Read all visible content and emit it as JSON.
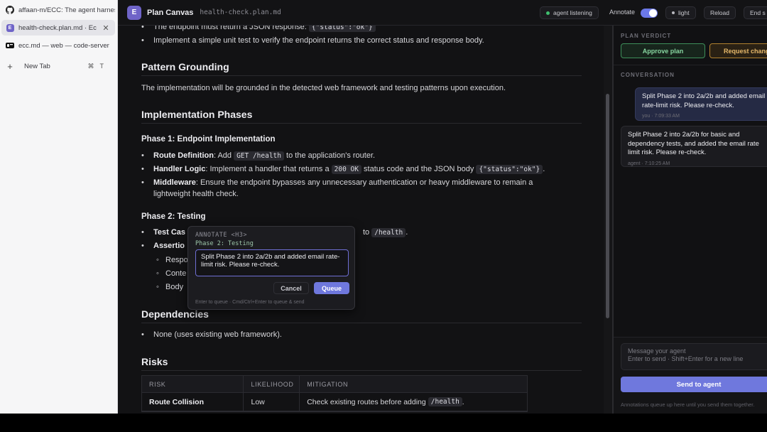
{
  "browser": {
    "tabs": [
      {
        "title": "affaan-m/ECC: The agent harness",
        "icon": "github-icon"
      },
      {
        "title": "health-check.plan.md · Ec",
        "icon": "plan-canvas-favicon",
        "close": "✕"
      },
      {
        "title": "ecc.md — web — code-server",
        "icon": "code-server-icon"
      }
    ],
    "new_tab": {
      "label": "New Tab",
      "shortcut_mod": "⌘",
      "shortcut_key": "T"
    }
  },
  "header": {
    "logo_letter": "E",
    "app_title": "Plan Canvas",
    "file_name": "health-check.plan.md",
    "status": "agent listening",
    "status_color": "#3fbf6f",
    "annotate_label": "Annotate",
    "annotate_on": true,
    "theme_label": "light",
    "reload_label": "Reload",
    "end_label": "End s"
  },
  "document": {
    "top_items": [
      {
        "text": "The endpoint must return a JSON response: ",
        "code": "{\"status\":\"ok\"}"
      },
      {
        "text": "Implement a simple unit test to verify the endpoint returns the correct status and response body."
      }
    ],
    "pattern_heading": "Pattern Grounding",
    "pattern_text": "The implementation will be grounded in the detected web framework and testing patterns upon execution.",
    "phases_heading": "Implementation Phases",
    "phase1_heading": "Phase 1: Endpoint Implementation",
    "phase1_items": [
      {
        "bold": "Route Definition",
        "text_a": ": Add ",
        "code_a": "GET /health",
        "text_b": " to the application's router."
      },
      {
        "bold": "Handler Logic",
        "text_a": ": Implement a handler that returns a ",
        "code_a": "200 OK",
        "text_b": " status code and the JSON body ",
        "code_b": "{\"status\":\"ok\"}",
        "text_c": "."
      },
      {
        "bold": "Middleware",
        "text_a": ": Ensure the endpoint bypasses any unnecessary authentication or heavy middleware to remain a",
        "text_b": "lightweight health check."
      }
    ],
    "phase2_heading": "Phase 2: Testing",
    "phase2_items": [
      {
        "bold": "Test Cas",
        "trail_text": "to ",
        "trail_code": "/health",
        "trail_end": "."
      },
      {
        "bold": "Assertio"
      }
    ],
    "phase2_subitems": [
      "Respo",
      "Conte",
      "Body"
    ],
    "deps_heading": "Dependencies",
    "deps_items": [
      "None (uses existing web framework)."
    ],
    "risks_heading": "Risks",
    "risks_table": {
      "headers": [
        "RISK",
        "LIKELIHOOD",
        "MITIGATION"
      ],
      "rows": [
        {
          "risk": "Route Collision",
          "likelihood": "Low",
          "mitigation": "Check existing routes before adding ",
          "mitigation_code": "/health",
          "mitigation_end": "."
        }
      ]
    }
  },
  "annotate_popup": {
    "kicker": "ANNOTATE <H3>",
    "target": "Phase 2: Testing",
    "text": "Split Phase 2 into 2a/2b and added email rate-limit risk. Please re-check.",
    "cancel_label": "Cancel",
    "queue_label": "Queue",
    "hint": "Enter to queue · Cmd/Ctrl+Enter to queue & send"
  },
  "panel": {
    "verdict_heading": "PLAN VERDICT",
    "approve_label": "Approve plan",
    "request_label": "Request changes",
    "conversation_heading": "CONVERSATION",
    "messages": [
      {
        "role": "user",
        "text": "Split Phase 2 into 2a/2b and added email rate-limit risk. Please re-check.",
        "meta": "you · 7:09:33 AM"
      },
      {
        "role": "agent",
        "text": "Split Phase 2 into 2a/2b for basic and dependency tests, and added the email rate limit risk. Please re-check.",
        "meta": "agent · 7:10:25 AM"
      }
    ],
    "compose_placeholder": "Message your agent",
    "compose_hint": "Enter to send · Shift+Enter for a new line",
    "send_label": "Send to agent",
    "footer": "Annotations queue up here until you send them together."
  }
}
